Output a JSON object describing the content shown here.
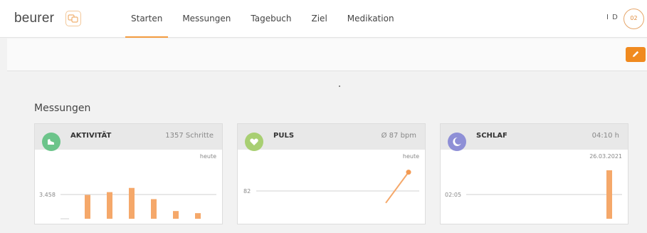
{
  "app": {
    "logo": "beurer",
    "user_initials": "I D",
    "avatar_label": "02"
  },
  "nav": {
    "tabs": [
      {
        "label": "Starten",
        "active": true
      },
      {
        "label": "Messungen",
        "active": false
      },
      {
        "label": "Tagebuch",
        "active": false
      },
      {
        "label": "Ziel",
        "active": false
      },
      {
        "label": "Medikation",
        "active": false
      }
    ]
  },
  "colors": {
    "accent": "#f08a1f",
    "bar": "#f5a86a",
    "activity": "#6cc48a",
    "pulse": "#a8cf72",
    "sleep": "#8e8fd6"
  },
  "icons": {
    "logo": "devices-icon",
    "edit": "pencil-icon",
    "activity": "shoe-icon",
    "pulse": "heart-icon",
    "sleep": "moon-icon"
  },
  "main": {
    "section_title": "Messungen"
  },
  "cards": [
    {
      "title": "AKTIVITÄT",
      "value": "1357 Schritte",
      "date": "heute",
      "reference_label": "3.458",
      "reference_value": 3458,
      "bars": [
        3400,
        3800,
        4400,
        2800,
        1100,
        800
      ]
    },
    {
      "title": "PULS",
      "value": "Ø 87 bpm",
      "date": "heute",
      "reference_label": "82",
      "reference_value": 82,
      "line": [
        75,
        93
      ]
    },
    {
      "title": "SCHLAF",
      "value": "04:10 h",
      "date": "26.03.2021",
      "reference_label": "02:05",
      "reference_value": 125,
      "bars": [
        250
      ]
    }
  ]
}
